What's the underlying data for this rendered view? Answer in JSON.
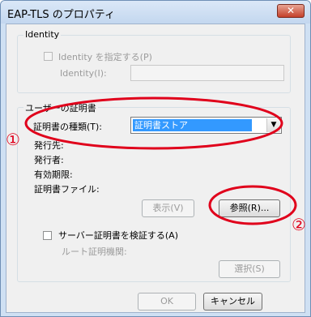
{
  "window": {
    "title": "EAP-TLS のプロパティ",
    "close_glyph": "✕"
  },
  "identity": {
    "legend": "Identity",
    "checkbox_label": "Identity を指定する(P)",
    "field_label": "Identity(I):",
    "field_value": ""
  },
  "user_cert": {
    "legend": "ユーザーの証明書",
    "type_label": "証明書の種類(T):",
    "type_value": "証明書ストア",
    "dropdown_glyph": "▼",
    "issued_to": "発行先:",
    "issuer": "発行者:",
    "expiry": "有効期限:",
    "cert_file": "証明書ファイル:",
    "view_button": "表示(V)",
    "browse_button": "参照(R)..."
  },
  "server": {
    "checkbox_label": "サーバー証明書を検証する(A)",
    "root_ca_label": "ルート証明機関:",
    "select_button": "選択(S)"
  },
  "footer": {
    "ok": "OK",
    "cancel": "キャンセル"
  },
  "annotations": {
    "marker_1": "①",
    "marker_2": "②",
    "color": "#e0001b"
  }
}
